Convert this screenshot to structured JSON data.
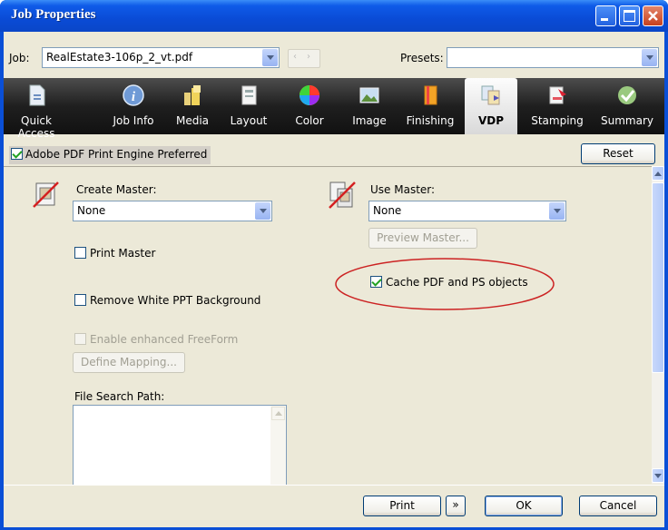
{
  "window": {
    "title": "Job Properties"
  },
  "job_row": {
    "job_label": "Job:",
    "job_value": "RealEstate3-106p_2_vt.pdf",
    "presets_label": "Presets:",
    "presets_value": ""
  },
  "tabs": [
    {
      "label": "Quick Access",
      "icon": "quick-access-icon",
      "active": false
    },
    {
      "label": "Job Info",
      "icon": "info-icon",
      "active": false
    },
    {
      "label": "Media",
      "icon": "media-icon",
      "active": false
    },
    {
      "label": "Layout",
      "icon": "layout-icon",
      "active": false
    },
    {
      "label": "Color",
      "icon": "color-wheel-icon",
      "active": false
    },
    {
      "label": "Image",
      "icon": "image-icon",
      "active": false
    },
    {
      "label": "Finishing",
      "icon": "finishing-icon",
      "active": false
    },
    {
      "label": "VDP",
      "icon": "vdp-icon",
      "active": true
    },
    {
      "label": "Stamping",
      "icon": "stamping-icon",
      "active": false
    },
    {
      "label": "Summary",
      "icon": "summary-check-icon",
      "active": false
    }
  ],
  "engine_bar": {
    "checkbox_label": "Adobe PDF Print Engine Preferred",
    "checked": true,
    "reset_label": "Reset"
  },
  "vdp": {
    "create_master_label": "Create Master:",
    "create_master_value": "None",
    "print_master_label": "Print Master",
    "remove_white_label": "Remove White PPT Background",
    "enhanced_freeform_label": "Enable enhanced FreeForm",
    "define_mapping_label": "Define Mapping...",
    "file_search_label": "File Search Path:",
    "use_master_label": "Use Master:",
    "use_master_value": "None",
    "preview_master_label": "Preview Master...",
    "cache_label": "Cache PDF and PS objects"
  },
  "bottom": {
    "print_label": "Print",
    "ok_label": "OK",
    "cancel_label": "Cancel"
  },
  "colors": {
    "titlebar": "#0a4bd6",
    "dialog_bg": "#ece9d8",
    "annotation": "#cc2222",
    "tab_strip": "#1f1f1f"
  }
}
